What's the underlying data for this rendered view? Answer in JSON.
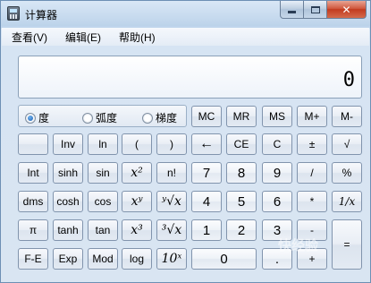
{
  "window": {
    "title": "计算器",
    "controls": {
      "minimize_icon": "minimize-icon",
      "maximize_icon": "maximize-icon",
      "close_label": "✕"
    }
  },
  "menu": [
    "查看(V)",
    "编辑(E)",
    "帮助(H)"
  ],
  "display": {
    "value": "0"
  },
  "angle_mode": {
    "options": [
      "度",
      "弧度",
      "梯度"
    ],
    "selected": "度"
  },
  "memory_buttons": [
    "MC",
    "MR",
    "MS",
    "M+",
    "M-"
  ],
  "rows": {
    "r1": [
      "",
      "Inv",
      "ln",
      "(",
      ")",
      "←",
      "CE",
      "C",
      "±",
      "√"
    ],
    "r2": [
      "Int",
      "sinh",
      "sin",
      "x²",
      "n!",
      "7",
      "8",
      "9",
      "/",
      "%"
    ],
    "r3": [
      "dms",
      "cosh",
      "cos",
      "xʸ",
      "ʸ√x",
      "4",
      "5",
      "6",
      "*",
      "1/x"
    ],
    "r4": [
      "π",
      "tanh",
      "tan",
      "x³",
      "³√x",
      "1",
      "2",
      "3",
      "-",
      "="
    ],
    "r5": [
      "F-E",
      "Exp",
      "Mod",
      "log",
      "10ˣ",
      "0",
      ".",
      "+"
    ]
  },
  "watermark": "快经验"
}
